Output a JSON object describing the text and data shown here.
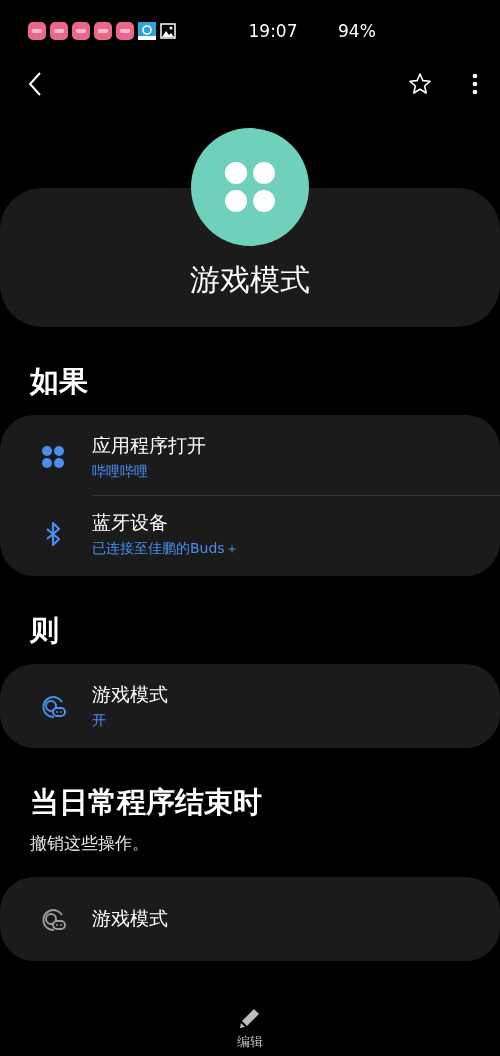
{
  "status_bar": {
    "notification_icons": [
      {
        "kind": "pink-app"
      },
      {
        "kind": "pink-app"
      },
      {
        "kind": "pink-app"
      },
      {
        "kind": "pink-app"
      },
      {
        "kind": "pink-app"
      },
      {
        "kind": "blue-app"
      },
      {
        "kind": "image"
      }
    ],
    "time": "19:07",
    "battery": "94%"
  },
  "header": {
    "title": "游戏模式"
  },
  "sections": [
    {
      "heading": "如果",
      "items": [
        {
          "kind": "apps",
          "title": "应用程序打开",
          "subtitle": "哔哩哔哩",
          "active": true
        },
        {
          "kind": "bluetooth",
          "title": "蓝牙设备",
          "subtitle": "已连接至佳鹏的Buds＋",
          "active": true
        }
      ]
    },
    {
      "heading": "则",
      "items": [
        {
          "kind": "game",
          "title": "游戏模式",
          "subtitle": "开",
          "active": true
        }
      ]
    },
    {
      "heading": "当日常程序结束时",
      "note": "撤销这些操作。",
      "items": [
        {
          "kind": "game",
          "title": "游戏模式",
          "active": false
        }
      ]
    }
  ],
  "bottom_bar": {
    "edit_label": "编辑"
  }
}
